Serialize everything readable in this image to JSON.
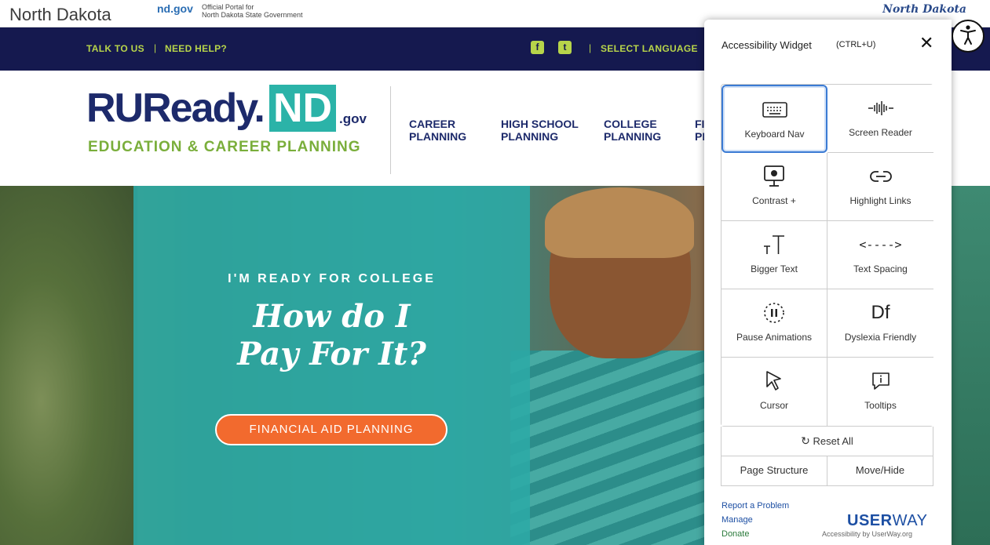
{
  "topbar": {
    "state_name": "North Dakota",
    "nd_gov": "nd.gov",
    "portal_line1": "Official Portal for",
    "portal_line2": "North Dakota State Government",
    "script_logo": "North Dakota"
  },
  "navbar": {
    "talk": "TALK TO US",
    "sep": "|",
    "help": "NEED HELP?",
    "facebook_icon": "f",
    "twitter_icon": "t",
    "language": "SELECT LANGUAGE"
  },
  "header": {
    "logo_ru": "RUReady.",
    "logo_nd": "ND",
    "logo_gov": ".gov",
    "logo_sub": "EDUCATION & CAREER PLANNING",
    "menu": [
      {
        "l1": "CAREER",
        "l2": "PLANNING"
      },
      {
        "l1": "HIGH SCHOOL",
        "l2": "PLANNING"
      },
      {
        "l1": "COLLEGE",
        "l2": "PLANNING"
      },
      {
        "l1": "FI",
        "l2": "PL"
      }
    ]
  },
  "hero": {
    "kicker": "I'M READY FOR COLLEGE",
    "title1": "How do I",
    "title2": "Pay For It?",
    "button": "FINANCIAL AID PLANNING"
  },
  "widget": {
    "title": "Accessibility Widget",
    "shortcut": "(CTRL+U)",
    "close": "✕",
    "tiles": [
      {
        "label": "Keyboard Nav",
        "icon": "keyboard-icon"
      },
      {
        "label": "Screen Reader",
        "icon": "soundwave-icon"
      },
      {
        "label": "Contrast +",
        "icon": "contrast-monitor-icon"
      },
      {
        "label": "Highlight Links",
        "icon": "link-icon"
      },
      {
        "label": "Bigger Text",
        "icon": "bigger-text-icon"
      },
      {
        "label": "Text Spacing",
        "icon": "text-spacing-icon"
      },
      {
        "label": "Pause Animations",
        "icon": "pause-animations-icon"
      },
      {
        "label": "Dyslexia Friendly",
        "icon": "dyslexia-icon"
      },
      {
        "label": "Cursor",
        "icon": "cursor-icon"
      },
      {
        "label": "Tooltips",
        "icon": "tooltip-icon"
      }
    ],
    "text_spacing_glyph": "<---->",
    "dyslexia_glyph": "Df",
    "reset": "Reset All",
    "page_structure": "Page Structure",
    "move_hide": "Move/Hide",
    "report": "Report a Problem",
    "manage": "Manage",
    "donate": "Donate",
    "brand_bold": "USER",
    "brand_light": "WAY",
    "brand_sub": "Accessibility by UserWay.org",
    "colors": {
      "accent": "#3b7bd4",
      "brand": "#1d4fa3",
      "donate": "#2a7a3a"
    }
  },
  "colors": {
    "navy": "#15194f",
    "green": "#b7d44a",
    "teal": "#2bb3a8",
    "orange": "#f26a2e"
  }
}
